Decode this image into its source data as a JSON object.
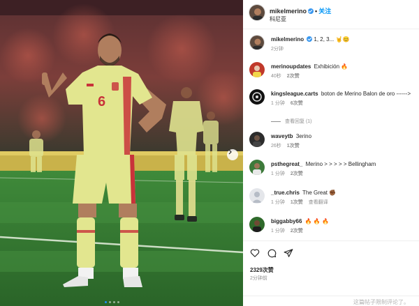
{
  "post": {
    "username": "mikelmerino",
    "follow_label": "关注",
    "location": "科尼亚",
    "caption_text": "1, 2, 3... 🤘😊",
    "caption_time": "2分钟"
  },
  "comments": [
    {
      "user": "merinoupdates",
      "text": "Exhibición 🔥",
      "time": "40秒",
      "likes": "2次赞",
      "reply": ""
    },
    {
      "user": "kingsleague.carts",
      "text": "boton de Merino Balon de oro ------>",
      "time": "1 分钟",
      "likes": "6次赞",
      "reply": ""
    },
    {
      "user": "waveytb",
      "text": "3erino",
      "time": "26秒",
      "likes": "1次赞",
      "reply": ""
    },
    {
      "user": "psthegreat_",
      "text": "Merino > > > > > Bellingham",
      "time": "1 分钟",
      "likes": "2次赞",
      "reply": ""
    },
    {
      "user": "_true.chris",
      "text": "The Great ✊🏾",
      "time": "1 分钟",
      "likes": "1次赞",
      "reply": "查看翻译"
    },
    {
      "user": "biggabby66",
      "text": "🔥 🔥 🔥",
      "time": "1 分钟",
      "likes": "2次赞",
      "reply": ""
    }
  ],
  "view_replies_label": "查看回复 (1)",
  "likes_count": "2329次赞",
  "posted_time": "2分钟前",
  "comments_restricted": "这篇帖子限制评论了。",
  "player": {
    "number": "6"
  },
  "icons": {
    "like": "heart-icon",
    "comment": "comment-icon",
    "share": "send-icon",
    "verified": "verified-badge-icon",
    "next": "chevron-right-icon"
  },
  "colors": {
    "follow": "#0095f6",
    "verified": "#3897f0",
    "pitch": "#2f6b2e",
    "kit": "#e2e68f",
    "kit_number": "#c8323a"
  }
}
